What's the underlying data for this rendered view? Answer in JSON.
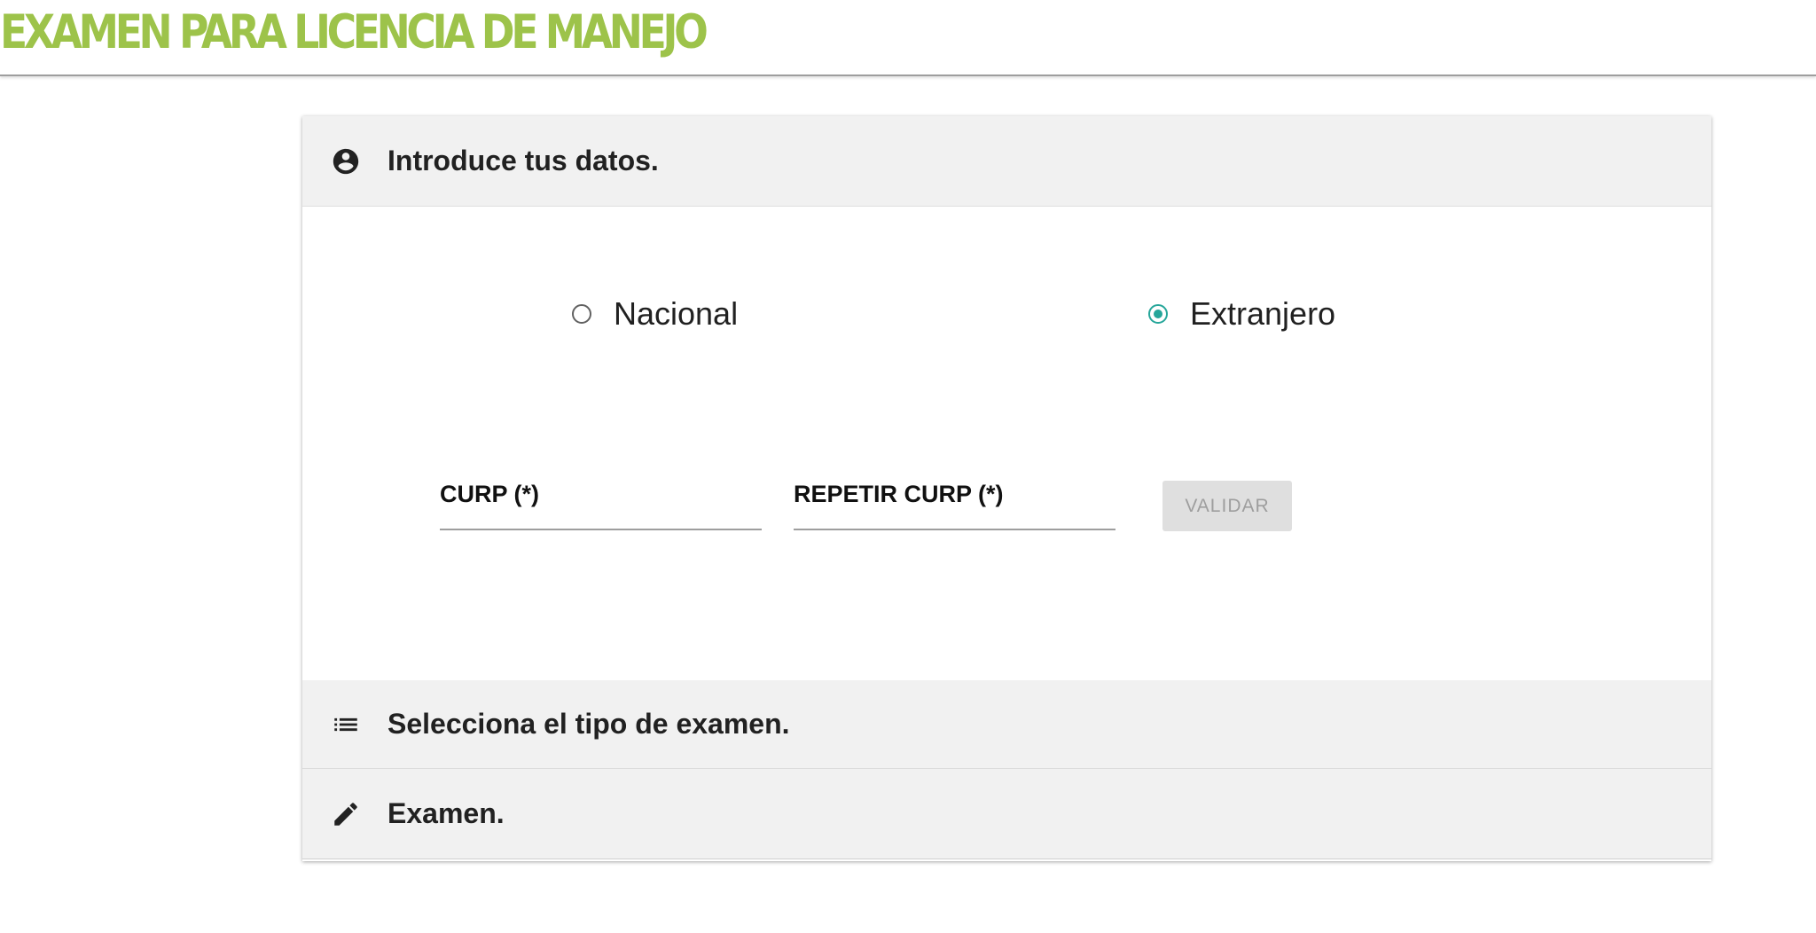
{
  "header": {
    "title": "EXAMEN PARA LICENCIA DE MANEJO",
    "title_color": "#9dc34a"
  },
  "steps": [
    {
      "icon": "account-circle-icon",
      "label": "Introduce tus datos."
    },
    {
      "icon": "list-icon",
      "label": "Selecciona el tipo de examen."
    },
    {
      "icon": "pencil-icon",
      "label": "Examen."
    }
  ],
  "form": {
    "nationality": {
      "options": [
        {
          "label": "Nacional",
          "checked": false
        },
        {
          "label": "Extranjero",
          "checked": true
        }
      ],
      "accent_color": "#26a69a"
    },
    "curp_label": "CURP (*)",
    "curp_value": "",
    "repeat_curp_label": "REPETIR CURP (*)",
    "repeat_curp_value": "",
    "validate_button": "VALIDAR",
    "validate_disabled": true
  }
}
